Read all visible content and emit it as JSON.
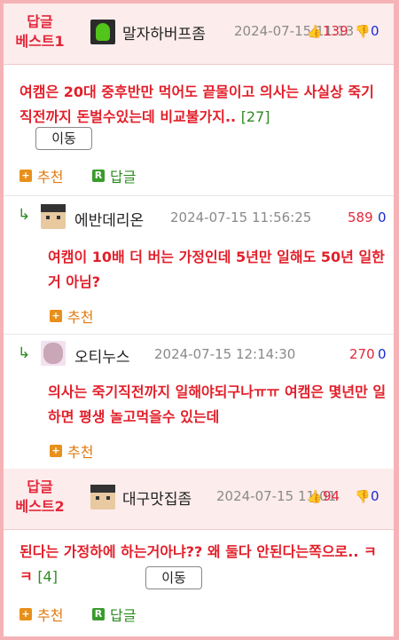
{
  "best1": {
    "label": "답글\n베스트1",
    "nick": "말자하버프좀",
    "date": "2024-07-15 11:13",
    "up": "139",
    "down": "0",
    "content": "여캠은 20대 중후반만 먹어도 끝물이고 의사는 사실상 죽기직전까지 돈벌수있는데 비교불가지..",
    "reply_count": "[27]",
    "move_label": "이동",
    "recommend_label": "추천",
    "reply_label": "답글"
  },
  "replies": [
    {
      "nick": "에반데리온",
      "date": "2024-07-15 11:56:25",
      "up": "589",
      "down": "0",
      "content": "여캠이 10배 더 버는 가정인데 5년만 일해도 50년 일한거 아님?",
      "recommend_label": "추천"
    },
    {
      "nick": "오티누스",
      "date": "2024-07-15 12:14:30",
      "up": "270",
      "down": "0",
      "content": "의사는 죽기직전까지 일해야되구나ㅠㅠ 여캠은 몇년만 일하면 평생 놀고먹을수 있는데",
      "recommend_label": "추천"
    }
  ],
  "best2": {
    "label": "답글\n베스트2",
    "nick": "대구맛집좀",
    "date": "2024-07-15 11:01",
    "up": "94",
    "down": "0",
    "content": "된다는 가정하에 하는거아냐?? 왜 둘다 안된다는쪽으로.. ㅋㅋ",
    "reply_count": "[4]",
    "move_label": "이동",
    "recommend_label": "추천",
    "reply_label": "답글"
  },
  "icons": {
    "thumb_up": "thumb-up-icon",
    "thumb_down": "thumb-down-icon",
    "recommend": "plus-square-icon",
    "reply": "r-square-icon",
    "reply_arrow": "reply-arrow-icon"
  }
}
